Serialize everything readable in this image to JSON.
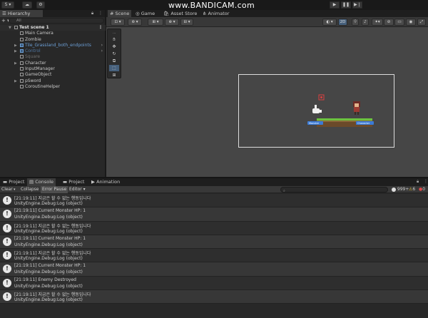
{
  "toolbar": {
    "account_label": "S",
    "watermark": "www.BANDICAM.com"
  },
  "hierarchy": {
    "tab": "Hierarchy",
    "search_placeholder": "All",
    "scene_name": "Test scene 1",
    "items": [
      {
        "label": "Main Camera",
        "style": "normal",
        "has_children": false
      },
      {
        "label": "Zombie",
        "style": "normal",
        "has_children": false
      },
      {
        "label": "Tile_Grassland_both_endpoints",
        "style": "blue",
        "has_children": true
      },
      {
        "label": "Control",
        "style": "blue-dim",
        "has_children": true
      },
      {
        "label": "Square",
        "style": "dim",
        "has_children": false
      },
      {
        "label": "Character",
        "style": "normal",
        "has_children": true
      },
      {
        "label": "InputManager",
        "style": "normal",
        "has_children": false
      },
      {
        "label": "GameObject",
        "style": "normal",
        "has_children": false
      },
      {
        "label": "pSword",
        "style": "normal",
        "has_children": true
      },
      {
        "label": "CoroutineHelper",
        "style": "normal",
        "has_children": false
      }
    ]
  },
  "scene": {
    "tabs": [
      "Scene",
      "Game",
      "Asset Store",
      "Animator"
    ],
    "active_tab": "Scene",
    "toggle_2d": "2D",
    "health_bar_left": "Monster",
    "health_bar_right": "Character"
  },
  "console": {
    "tabs": [
      "Project",
      "Console",
      "Project",
      "Animation"
    ],
    "active_tab": "Console",
    "buttons": {
      "clear": "Clear",
      "collapse": "Collapse",
      "error_pause": "Error Pause",
      "editor": "Editor"
    },
    "log_count": "999+",
    "warn_count": "6",
    "error_count": "0",
    "entries": [
      {
        "message": "[21:19:11] 지금은 할 수 없는 행동입니다",
        "source": "UnityEngine.Debug:Log (object)"
      },
      {
        "message": "[21:19:11] Current Monster HP: 1",
        "source": "UnityEngine.Debug:Log (object)"
      },
      {
        "message": "[21:19:11] 지금은 할 수 없는 행동입니다",
        "source": "UnityEngine.Debug:Log (object)"
      },
      {
        "message": "[21:19:11] Current Monster HP: 1",
        "source": "UnityEngine.Debug:Log (object)"
      },
      {
        "message": "[21:19:11] 지금은 할 수 없는 행동입니다",
        "source": "UnityEngine.Debug:Log (object)"
      },
      {
        "message": "[21:19:11] Current Monster HP: 1",
        "source": "UnityEngine.Debug:Log (object)"
      },
      {
        "message": "[21:19:11] Enemy Destroyed",
        "source": "UnityEngine.Debug:Log (object)"
      },
      {
        "message": "[21:19:11] 지금은 할 수 없는 행동입니다",
        "source": "UnityEngine.Debug:Log (object)"
      }
    ]
  }
}
